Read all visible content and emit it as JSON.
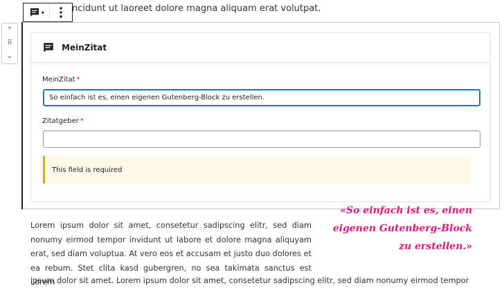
{
  "previous_block": {
    "text": "ncidunt ut laoreet dolore magna aliquam erat volutpat."
  },
  "toolbar": {
    "block_icon": "quote-block-icon",
    "more_icon": "more-vertical-icon",
    "caret": "▾"
  },
  "mover": {
    "up": "⌃",
    "drag": "⠿",
    "down": "⌄"
  },
  "block": {
    "title": "MeinZitat",
    "fields": [
      {
        "label": "MeinZitat",
        "required_mark": "*",
        "value": "So einfach ist es, einen eigenen Gutenberg-Block zu erstellen."
      },
      {
        "label": "Zitatgeber",
        "required_mark": "*",
        "value": ""
      }
    ],
    "notice": "This field is required"
  },
  "content": {
    "paragraph": "Lorem ipsum dolor sit amet, consetetur sadipscing elitr, sed diam nonumy eirmod tempor invidunt ut labore et dolore magna aliquyam erat, sed diam voluptua. At vero eos et accusam et justo duo dolores et ea rebum. Stet clita kasd gubergren, no sea takimata sanctus est Lorem",
    "paragraph_last_line": "ipsum dolor sit amet. Lorem ipsum dolor sit amet, consetetur sadipscing elitr, sed diam nonumy eirmod tempor",
    "pull_quote": "«So einfach ist es, einen eigenen Gutenberg-Block zu erstellen.»"
  },
  "colors": {
    "accent": "#2271b1",
    "quote": "#d61a7f",
    "notice_border": "#dba617",
    "notice_bg": "#fcf9e8"
  }
}
